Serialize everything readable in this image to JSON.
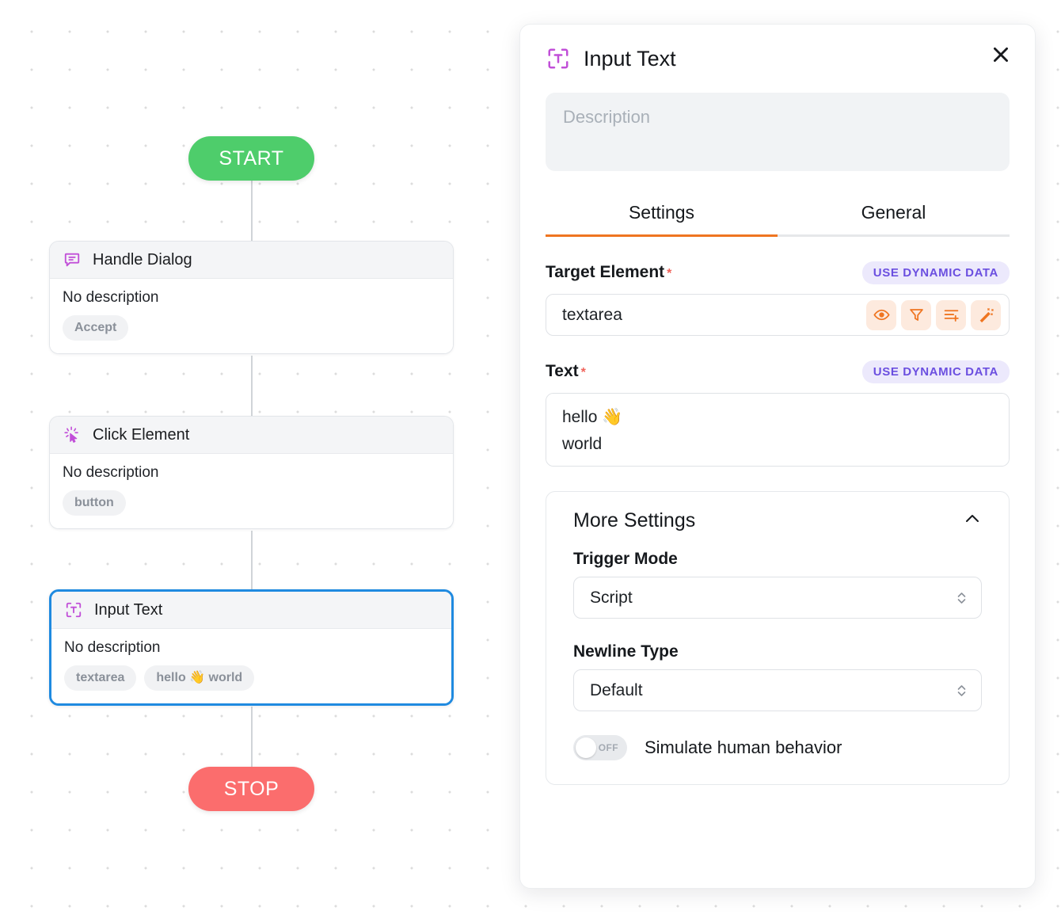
{
  "canvas": {
    "start_label": "START",
    "stop_label": "STOP",
    "nodes": [
      {
        "icon": "speech-bubble-icon",
        "title": "Handle Dialog",
        "description": "No description",
        "chips": [
          "Accept"
        ],
        "selected": false
      },
      {
        "icon": "click-cursor-icon",
        "title": "Click Element",
        "description": "No description",
        "chips": [
          "button"
        ],
        "selected": false
      },
      {
        "icon": "input-text-icon",
        "title": "Input Text",
        "description": "No description",
        "chips": [
          "textarea",
          "hello 👋 world"
        ],
        "selected": true
      }
    ]
  },
  "panel": {
    "icon": "input-text-icon",
    "title": "Input Text",
    "close_icon": "close-icon",
    "description": {
      "value": "",
      "placeholder": "Description"
    },
    "tabs": [
      {
        "label": "Settings",
        "active": true
      },
      {
        "label": "General",
        "active": false
      }
    ],
    "target_element": {
      "label": "Target Element",
      "required_marker": "*",
      "dynamic_data_label": "USE DYNAMIC DATA",
      "value": "textarea",
      "icons": [
        "eye-icon",
        "filter-icon",
        "list-plus-icon",
        "magic-wand-icon"
      ]
    },
    "text": {
      "label": "Text",
      "required_marker": "*",
      "dynamic_data_label": "USE DYNAMIC DATA",
      "value": "hello 👋\nworld"
    },
    "more_settings": {
      "title": "More Settings",
      "collapse_icon": "chevron-up-icon",
      "trigger_mode": {
        "label": "Trigger Mode",
        "value": "Script"
      },
      "newline_type": {
        "label": "Newline Type",
        "value": "Default"
      },
      "simulate_human": {
        "label": "Simulate human behavior",
        "state": "OFF"
      }
    }
  },
  "colors": {
    "start_green": "#4ecd6b",
    "stop_red": "#fb6d6d",
    "selected_blue": "#1f8ae0",
    "tab_accent_orange": "#ef7521",
    "dynamic_purple": "#6b4fe0",
    "node_icon_purple": "#c14fd8",
    "required_red": "#f0635b"
  }
}
